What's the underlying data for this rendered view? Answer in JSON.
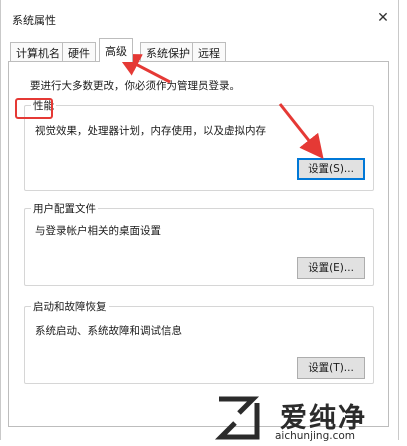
{
  "window": {
    "title": "系统属性",
    "close_glyph": "✕"
  },
  "tabs": [
    {
      "label": "计算机名",
      "active": false
    },
    {
      "label": "硬件",
      "active": false
    },
    {
      "label": "高级",
      "active": true
    },
    {
      "label": "系统保护",
      "active": false
    },
    {
      "label": "远程",
      "active": false
    }
  ],
  "notice": "要进行大多数更改，你必须作为管理员登录。",
  "groups": {
    "performance": {
      "title": "性能",
      "description": "视觉效果，处理器计划，内存使用，以及虚拟内存",
      "button": "设置(S)..."
    },
    "user_profiles": {
      "title": "用户配置文件",
      "description": "与登录帐户相关的桌面设置",
      "button": "设置(E)..."
    },
    "startup_recovery": {
      "title": "启动和故障恢复",
      "description": "系统启动、系统故障和调试信息",
      "button": "设置(T)..."
    }
  },
  "watermark": {
    "brand": "爱纯净",
    "url": "aichunjing.com"
  },
  "colors": {
    "annotation_red": "#e53935",
    "button_focus": "#0078d7"
  }
}
